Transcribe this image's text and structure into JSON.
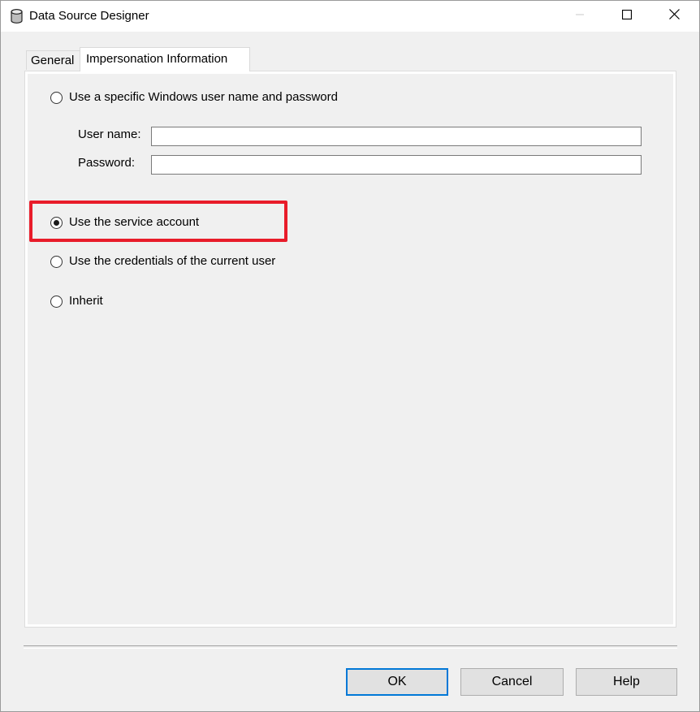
{
  "window": {
    "title": "Data Source Designer",
    "icons": {
      "app": "database-icon",
      "minimize": "minimize-icon",
      "maximize": "maximize-icon",
      "close": "close-icon"
    }
  },
  "tabs": [
    {
      "label": "General",
      "active": false
    },
    {
      "label": "Impersonation Information",
      "active": true
    }
  ],
  "options": {
    "specific_user": {
      "label": "Use a specific Windows user name and password",
      "checked": false
    },
    "username_label": "User name:",
    "username_value": "",
    "password_label": "Password:",
    "password_value": "",
    "service_account": {
      "label": "Use the service account",
      "checked": true
    },
    "current_user": {
      "label": "Use the credentials of the current user",
      "checked": false
    },
    "inherit": {
      "label": "Inherit",
      "checked": false
    }
  },
  "buttons": {
    "ok": "OK",
    "cancel": "Cancel",
    "help": "Help"
  },
  "colors": {
    "highlight": "#e81c2a",
    "default_button_border": "#0078d7"
  }
}
